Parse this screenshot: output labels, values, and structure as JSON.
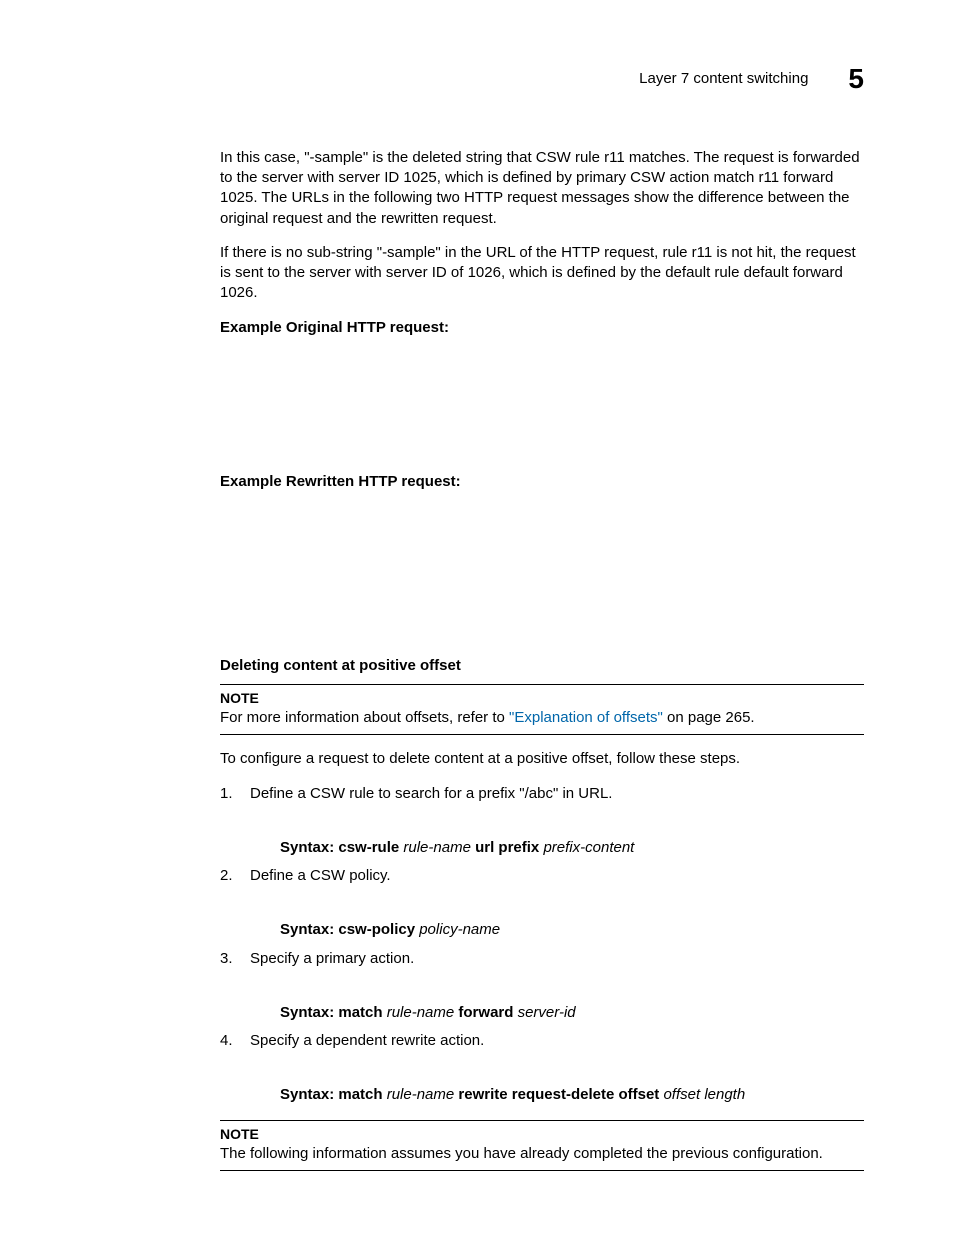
{
  "header": {
    "title": "Layer 7 content switching",
    "number": "5"
  },
  "p1": "In this case, \"-sample\" is the deleted string that CSW rule r11 matches. The request is forwarded to the server with server ID 1025, which is defined by primary CSW action match r11 forward 1025. The URLs in the following two HTTP request messages show the difference between the original request and the rewritten request.",
  "p2": "If there is no sub-string \"-sample\" in the URL of the HTTP request, rule r11 is not hit, the request is sent to the server with server ID of 1026, which is defined by the default rule default forward 1026.",
  "ex1": "Example Original HTTP request:",
  "ex2": "Example Rewritten HTTP request:",
  "subhead": "Deleting content at positive offset",
  "note1": {
    "label": "NOTE",
    "prefix": "For more information about offsets, refer to ",
    "link": "\"Explanation of offsets\"",
    "suffix": " on page 265."
  },
  "intro": "To configure a request to delete content at a positive offset, follow these steps.",
  "steps": {
    "s1": "Define a CSW rule to search for a prefix \"/abc\" in URL.",
    "syn1": {
      "lead": "Syntax:  csw-rule ",
      "a": "rule-name",
      "mid": " url prefix ",
      "b": "prefix-content"
    },
    "s2": "Define a CSW policy.",
    "syn2": {
      "lead": "Syntax:  csw-policy ",
      "a": "policy-name"
    },
    "s3": "Specify a primary action.",
    "syn3": {
      "lead": "Syntax:  match ",
      "a": "rule-name",
      "mid": " forward ",
      "b": "server-id"
    },
    "s4": "Specify a dependent rewrite action.",
    "syn4": {
      "lead": "Syntax:  match ",
      "a": "rule-name",
      "mid": " rewrite request-delete offset ",
      "b": "offset  length"
    }
  },
  "note2": {
    "label": "NOTE",
    "text": "The following information assumes you have already completed the previous configuration."
  }
}
